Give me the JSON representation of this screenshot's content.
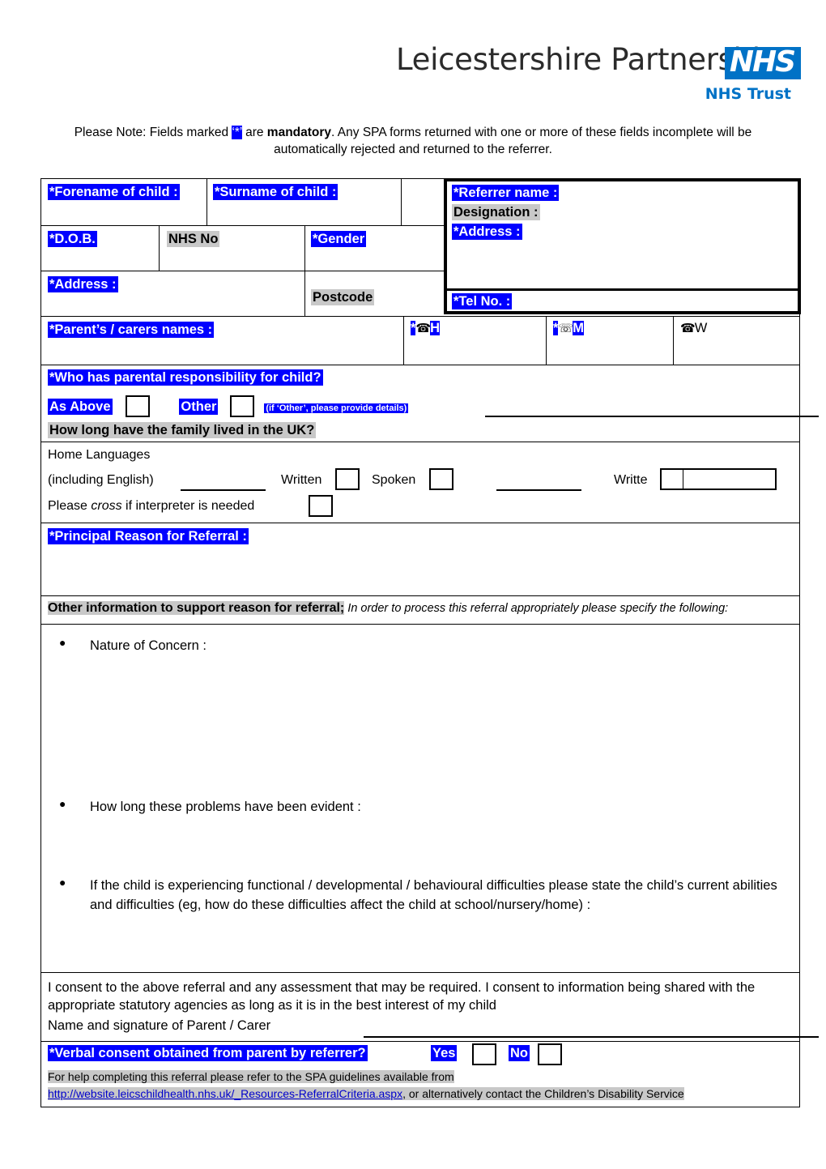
{
  "logo": {
    "main": "Leicestershire Partnership",
    "nhs": "NHS",
    "trust": "NHS Trust"
  },
  "note": {
    "part1": "Please Note: Fields marked ",
    "marker": "‘*’",
    "part2": " are ",
    "bold": "mandatory",
    "part3": ". Any SPA forms returned with one or more of these fields incomplete will be automatically rejected and returned to the referrer."
  },
  "child": {
    "forename": "*Forename of child :",
    "surname": "*Surname of child :",
    "dob": "*D.O.B.",
    "nhs_no": "NHS No",
    "gender": "*Gender",
    "address": "*Address :",
    "postcode": "Postcode"
  },
  "referrer": {
    "name": "*Referrer name :",
    "designation": "Designation :",
    "address": "*Address :",
    "tel": "*Tel No. :"
  },
  "parent": {
    "names": "*Parent’s / carers names :",
    "phone_home_star": "*",
    "phone_home_icon": "☎",
    "phone_home": "H",
    "phone_mobile_star": "*",
    "phone_mobile_icon": "☏",
    "phone_mobile": "M",
    "phone_work_icon": "☎",
    "phone_work": "W"
  },
  "responsibility": {
    "question": "*Who has parental responsibility for child?",
    "as_above": "As Above",
    "other": "Other",
    "other_hint": "(if ‘Other’, please provide details)",
    "uk_question": "How long have the family lived in the UK?"
  },
  "languages": {
    "title": "Home Languages",
    "subtitle": "(including English)",
    "written": "Written",
    "spoken": "Spoken",
    "written2": "Writte",
    "interpreter_pre": "Please ",
    "interpreter_italic": "cross",
    "interpreter_post": " if interpreter is needed"
  },
  "referral": {
    "principal_reason": "*Principal Reason for Referral :",
    "other_info_bold": "Other information to support reason for referral;",
    "other_info_italic": " In order to process this referral appropriately please specify the following:",
    "bullets": [
      "Nature of Concern :",
      "How long these problems have been evident :",
      "If the child is experiencing functional / developmental / behavioural difficulties please state the child’s current abilities and difficulties (eg, how do these difficulties affect the child at school/nursery/home) :"
    ]
  },
  "consent": {
    "text": "I consent to the above referral and any assessment that may be required.  I consent to information being shared with the appropriate statutory agencies as long as it is in the best interest of my child",
    "signature_label": "Name and signature of Parent / Carer",
    "verbal_question": "*Verbal consent obtained from parent by referrer?",
    "yes": "Yes",
    "no": "No"
  },
  "footer": {
    "help_text": "For help completing this referral please refer to the SPA guidelines available from",
    "url": "http://website.leicschildhealth.nhs.uk/_Resources-ReferralCriteria.aspx",
    "after_url": ", or alternatively contact the Children’s Disability Service"
  },
  "colors": {
    "mandatory_highlight": "#0000ff",
    "optional_highlight": "#c8c8c8",
    "nhs_blue": "#0072c6",
    "link": "#0000cc"
  }
}
